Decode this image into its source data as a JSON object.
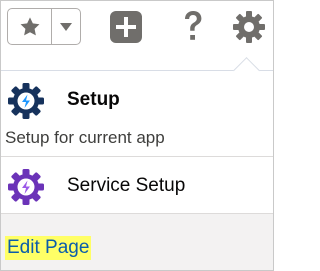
{
  "toolbar": {
    "favorites_icon": "star-icon",
    "favorites_menu_icon": "caret-down-icon",
    "new_icon": "plus-icon",
    "help_icon": "question-icon",
    "setup_icon": "gear-icon"
  },
  "menu": {
    "setup": {
      "title": "Setup",
      "subtitle": "Setup for current app",
      "icon": "setup-gear-icon",
      "icon_color": "#16325c"
    },
    "service_setup": {
      "label": "Service Setup",
      "icon": "service-setup-gear-icon",
      "icon_color": "#6b33b8"
    },
    "footer": {
      "edit_page_label": "Edit Page",
      "highlight_color": "#ffff66"
    }
  }
}
